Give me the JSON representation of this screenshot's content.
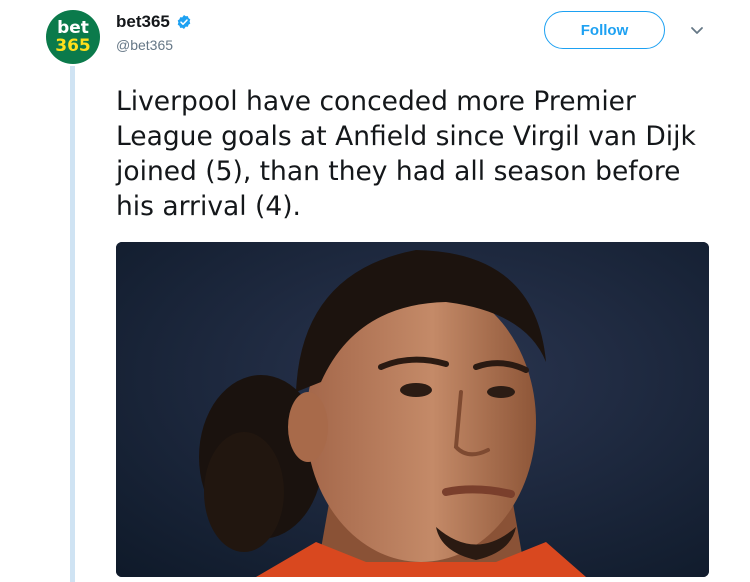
{
  "tweet": {
    "author": {
      "display_name": "bet365",
      "handle": "@bet365",
      "avatar_line1": "bet",
      "avatar_line2": "365",
      "verified_icon": "verified-badge-icon"
    },
    "follow_label": "Follow",
    "menu_icon": "chevron-down-icon",
    "text": "Liverpool have conceded more Premier League goals at Anfield since Virgil van Dijk joined (5), than they had all season before his arrival (4).",
    "media": {
      "type": "photo",
      "description": ""
    }
  },
  "colors": {
    "brand_green": "#0b7a4b",
    "brand_yellow": "#ffdf1b",
    "twitter_blue": "#1da1f2",
    "thread_line": "#cfe3f3"
  }
}
